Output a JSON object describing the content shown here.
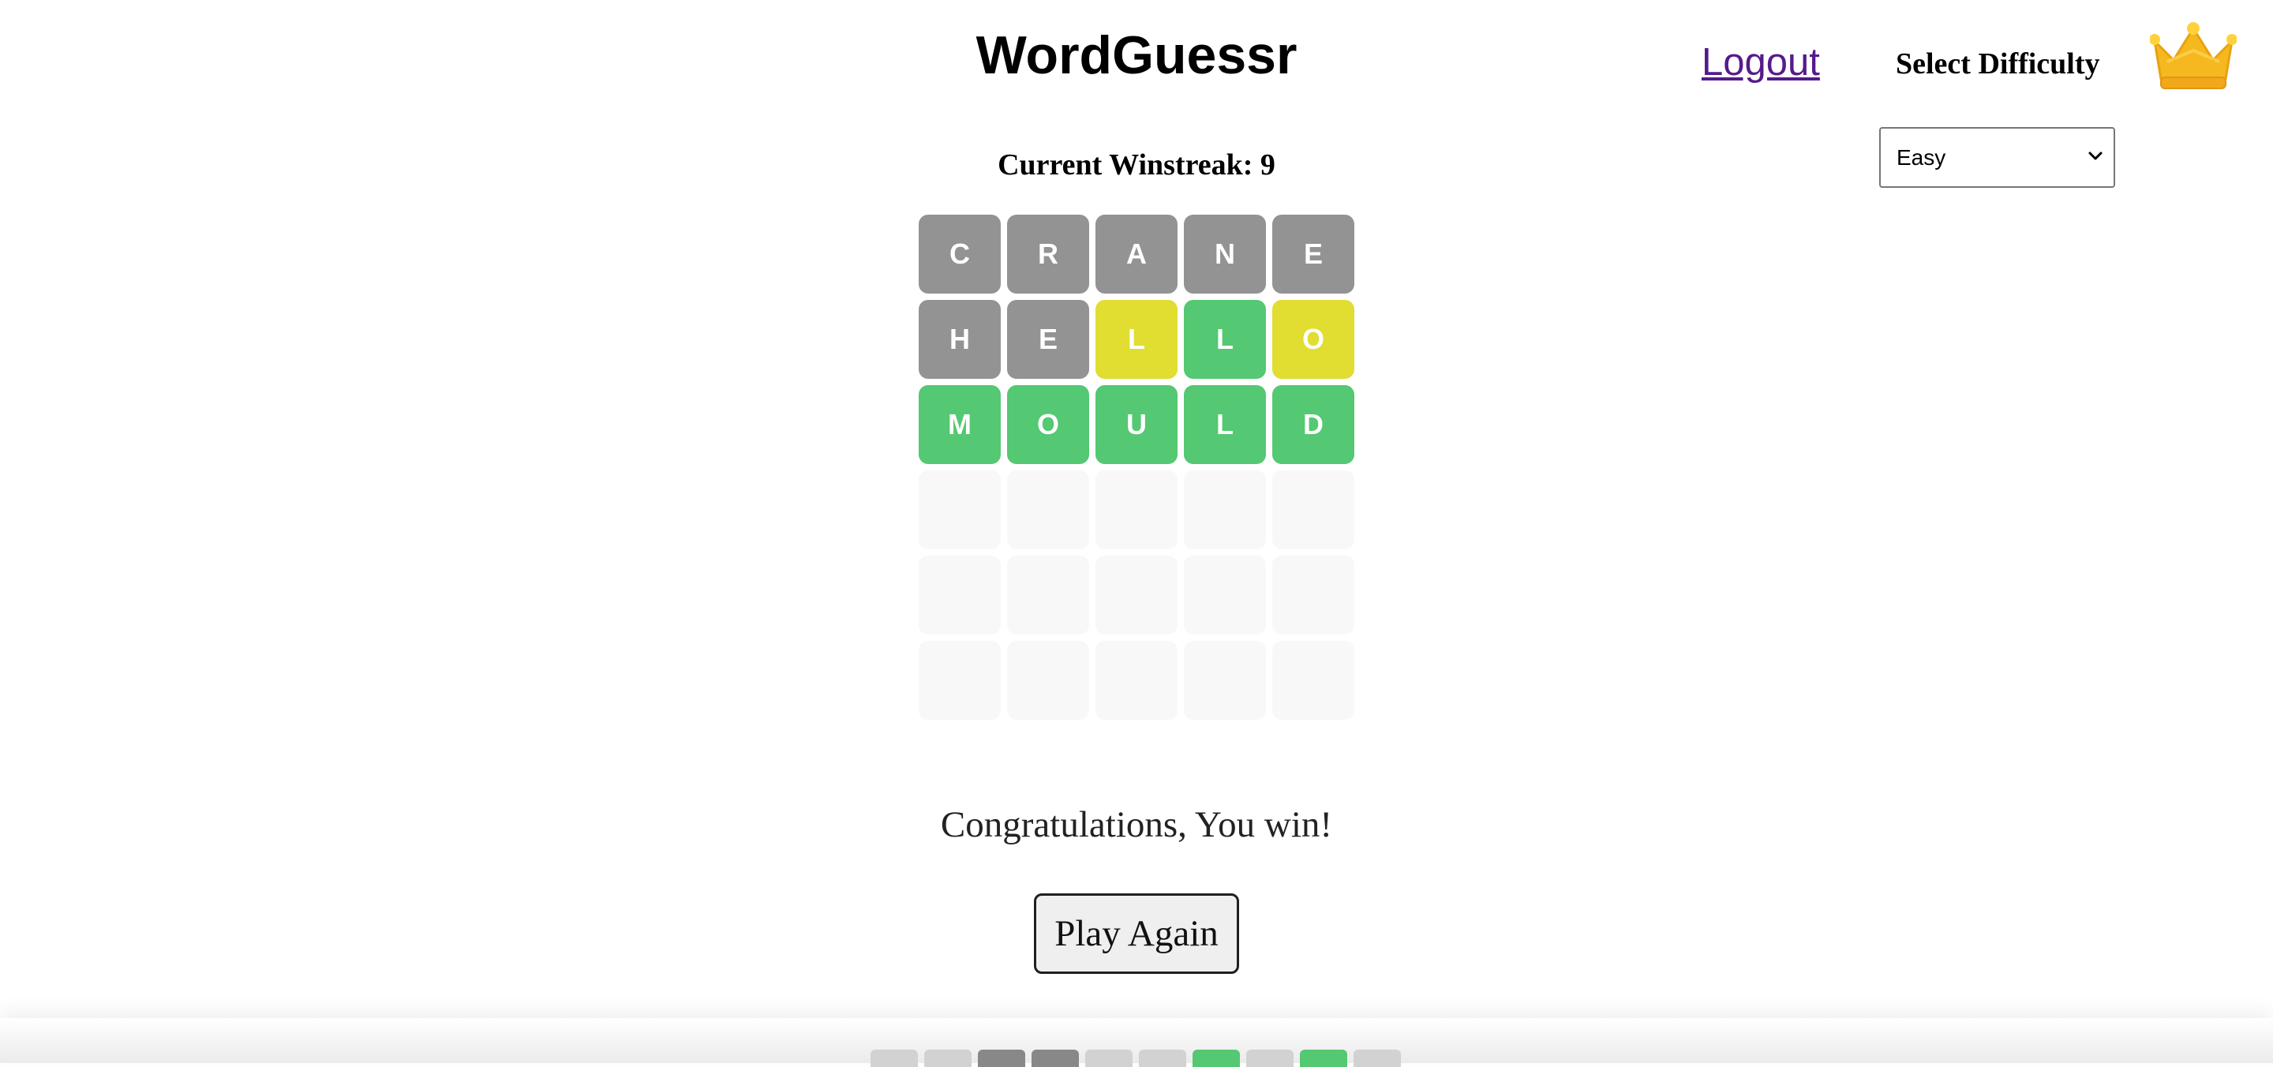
{
  "header": {
    "title": "WordGuessr",
    "logout_label": "Logout",
    "difficulty_label": "Select Difficulty",
    "crown_icon": "crown-icon",
    "difficulty_selected": "Easy",
    "difficulty_options": [
      "Easy"
    ]
  },
  "winstreak": {
    "label": "Current Winstreak:",
    "value": 9,
    "text": "Current Winstreak: 9"
  },
  "colors": {
    "absent": "#939393",
    "present": "#e1dd31",
    "correct": "#54c872",
    "empty": "#f8f8f8",
    "mini_light": "#d2d2d2",
    "mini_dark": "#888888"
  },
  "board": {
    "rows": [
      {
        "letters": [
          "C",
          "R",
          "A",
          "N",
          "E"
        ],
        "states": [
          "absent",
          "absent",
          "absent",
          "absent",
          "absent"
        ]
      },
      {
        "letters": [
          "H",
          "E",
          "L",
          "L",
          "O"
        ],
        "states": [
          "absent",
          "absent",
          "present",
          "correct",
          "present"
        ]
      },
      {
        "letters": [
          "M",
          "O",
          "U",
          "L",
          "D"
        ],
        "states": [
          "correct",
          "correct",
          "correct",
          "correct",
          "correct"
        ]
      },
      {
        "letters": [
          "",
          "",
          "",
          "",
          ""
        ],
        "states": [
          "empty",
          "empty",
          "empty",
          "empty",
          "empty"
        ]
      },
      {
        "letters": [
          "",
          "",
          "",
          "",
          ""
        ],
        "states": [
          "empty",
          "empty",
          "empty",
          "empty",
          "empty"
        ]
      },
      {
        "letters": [
          "",
          "",
          "",
          "",
          ""
        ],
        "states": [
          "empty",
          "empty",
          "empty",
          "empty",
          "empty"
        ]
      }
    ]
  },
  "result": {
    "message": "Congratulations, You win!",
    "play_again_label": "Play Again"
  },
  "keyboard_peek": {
    "keys": [
      "mini_light",
      "mini_light",
      "mini_dark",
      "mini_dark",
      "mini_light",
      "mini_light",
      "correct",
      "mini_light",
      "correct",
      "mini_light"
    ]
  }
}
